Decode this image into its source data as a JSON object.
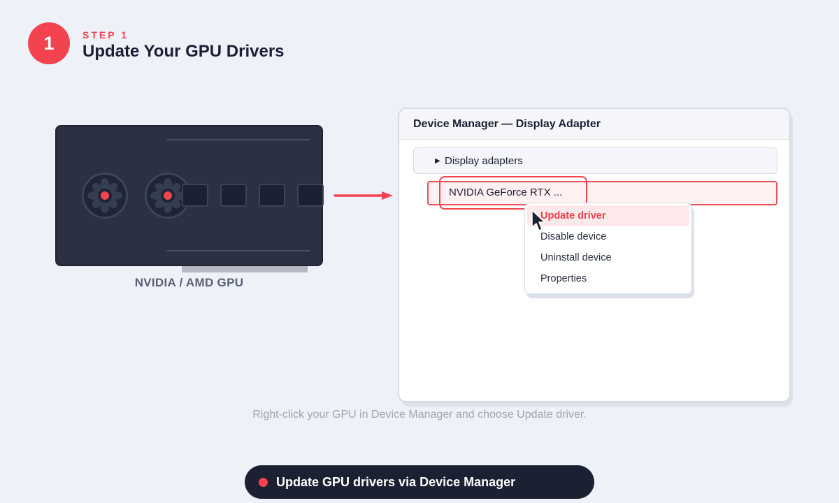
{
  "step": {
    "number": "1",
    "label": "STEP 1",
    "title": "Update Your GPU Drivers"
  },
  "gpu": {
    "caption": "NVIDIA / AMD GPU"
  },
  "device_manager": {
    "title": "Device Manager — Display Adapter",
    "category": "Display adapters",
    "device": "NVIDIA GeForce RTX ..."
  },
  "context_menu": {
    "items": [
      {
        "label": "Update driver",
        "active": true
      },
      {
        "label": "Disable device",
        "active": false
      },
      {
        "label": "Uninstall device",
        "active": false
      },
      {
        "label": "Properties",
        "active": false
      }
    ]
  },
  "instruction": "Right-click your GPU in Device Manager and choose Update driver.",
  "footer_pill": {
    "label": "Update GPU drivers via Device Manager"
  },
  "colors": {
    "accent": "#f2434f",
    "dark": "#1b2033",
    "background": "#eef1f8"
  },
  "icons": {
    "fan": "fan-icon",
    "arrow": "arrow-right-icon",
    "cursor": "mouse-pointer-icon",
    "expand": "triangle-right-icon"
  }
}
